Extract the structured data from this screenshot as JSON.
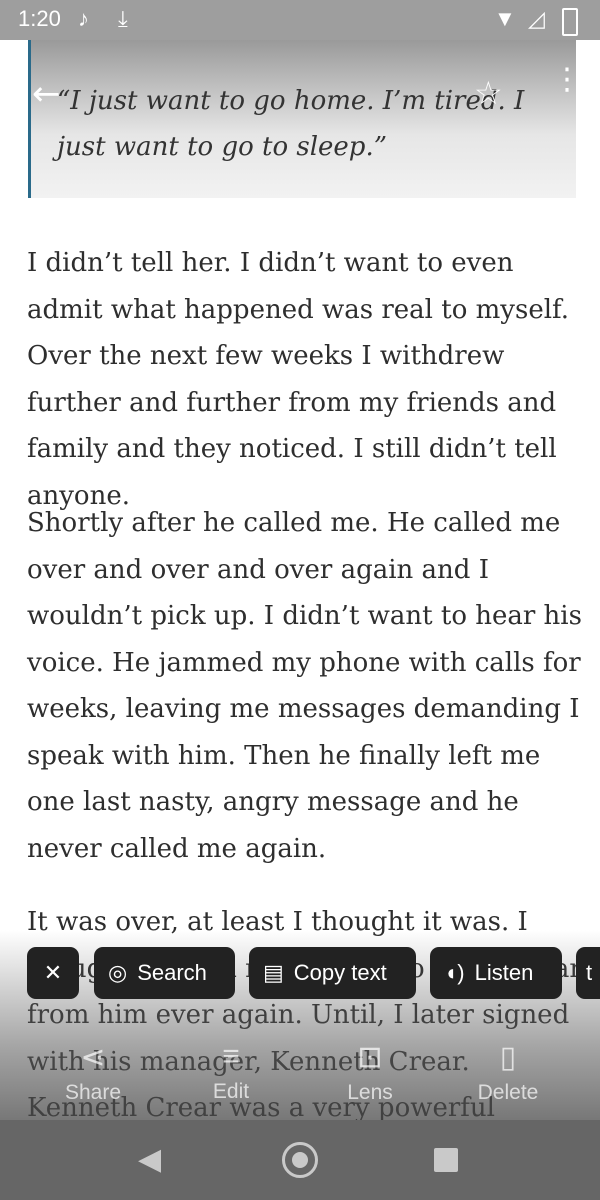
{
  "status_bar": {
    "time": "1:20",
    "icons": [
      "tiktok-icon",
      "download-icon",
      "wifi-icon",
      "signal-icon",
      "battery-icon"
    ]
  },
  "quote": "“I just want to go home. I’m tired. I just want to go to sleep.”",
  "paragraphs": [
    "I didn’t tell her. I didn’t want to even admit what happened was real to myself. Over the next few weeks I withdrew further and further from my friends and family and they noticed. I still didn’t tell anyone.",
    "Shortly after he called me. He called me over and over and over again and I wouldn’t pick up. I didn’t want to hear his voice. He jammed my phone with calls for weeks, leaving me messages demanding I speak with him. Then he finally left me one last nasty, angry message and he never called me again.",
    "It was over, at least I thought it was. I thought I would never have to see or hear from him ever again. Until, I later signed with his manager, Kenneth Crear. Kenneth Crear was a very powerful manager who I"
  ],
  "lens_chips": {
    "close": "✕",
    "search": "Search",
    "copy_text": "Copy text",
    "listen": "Listen",
    "more": "t"
  },
  "photo_actions": {
    "share": "Share",
    "edit": "Edit",
    "lens": "Lens",
    "delete": "Delete"
  }
}
